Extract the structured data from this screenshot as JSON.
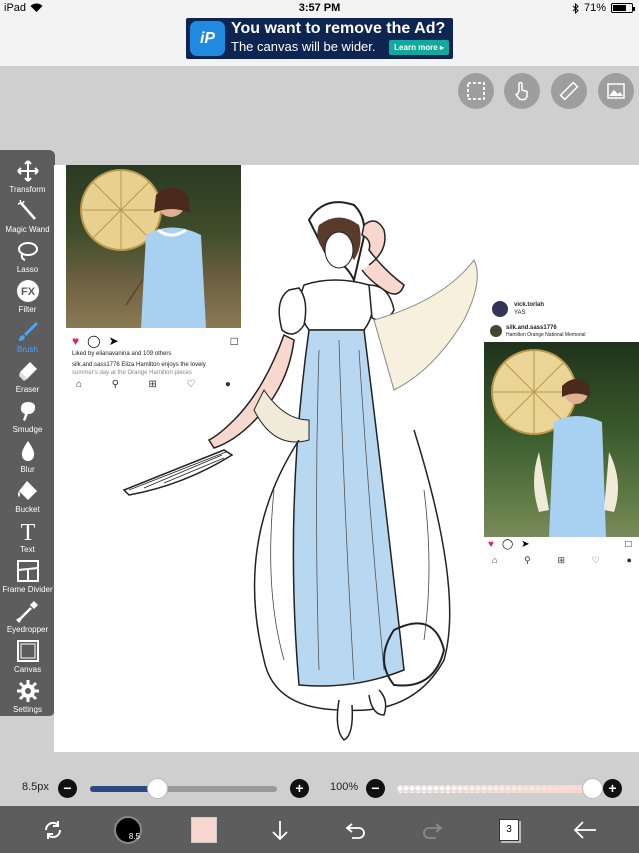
{
  "status_bar": {
    "device": "iPad",
    "time": "3:57 PM",
    "battery": "71%"
  },
  "ad": {
    "logo_text": "iP",
    "title": "You want to remove the Ad?",
    "subtitle": "The canvas will be wider.",
    "button": "Learn more"
  },
  "tools": [
    {
      "label": "Transform",
      "icon": "move-arrows-icon"
    },
    {
      "label": "Magic Wand",
      "icon": "magic-wand-icon"
    },
    {
      "label": "Lasso",
      "icon": "lasso-icon"
    },
    {
      "label": "Filter",
      "icon": "fx-icon"
    },
    {
      "label": "Brush",
      "icon": "brush-icon"
    },
    {
      "label": "Eraser",
      "icon": "eraser-icon"
    },
    {
      "label": "Smudge",
      "icon": "smudge-icon"
    },
    {
      "label": "Blur",
      "icon": "droplet-icon"
    },
    {
      "label": "Bucket",
      "icon": "bucket-icon"
    },
    {
      "label": "Text",
      "icon": "text-icon"
    },
    {
      "label": "Frame Divider",
      "icon": "frame-divider-icon"
    },
    {
      "label": "Eyedropper",
      "icon": "eyedropper-icon"
    },
    {
      "label": "Canvas",
      "icon": "canvas-icon"
    },
    {
      "label": "Settings",
      "icon": "gear-icon"
    }
  ],
  "filter_glyph": "FX",
  "text_glyph": "T",
  "active_tool": "Brush",
  "instagram_left": {
    "liked_by": "Liked by elianavanina and 109 others",
    "caption": "silk.and.sass1776 Eliza Hamilton enjoys the lovely",
    "caption2": "summer's day at the Orange Hamilton pieces"
  },
  "instagram_right": {
    "user": "vick.torlah",
    "comment": "YAS",
    "account": "silk.and.sass1776",
    "location": "Hamilton Orange National Memorial"
  },
  "brush": {
    "size_label": "8.5px",
    "size_value": 8.5,
    "size_fraction": 0.36,
    "opacity_label": "100%",
    "opacity_fraction": 1.0
  },
  "bottom": {
    "brush_preview_label": "8.5",
    "layer_count": "3"
  },
  "colors": {
    "current_color": "#f8d8ce",
    "toolbar_bg": "#5d5d5d",
    "active_blue": "#4aa3ff"
  }
}
